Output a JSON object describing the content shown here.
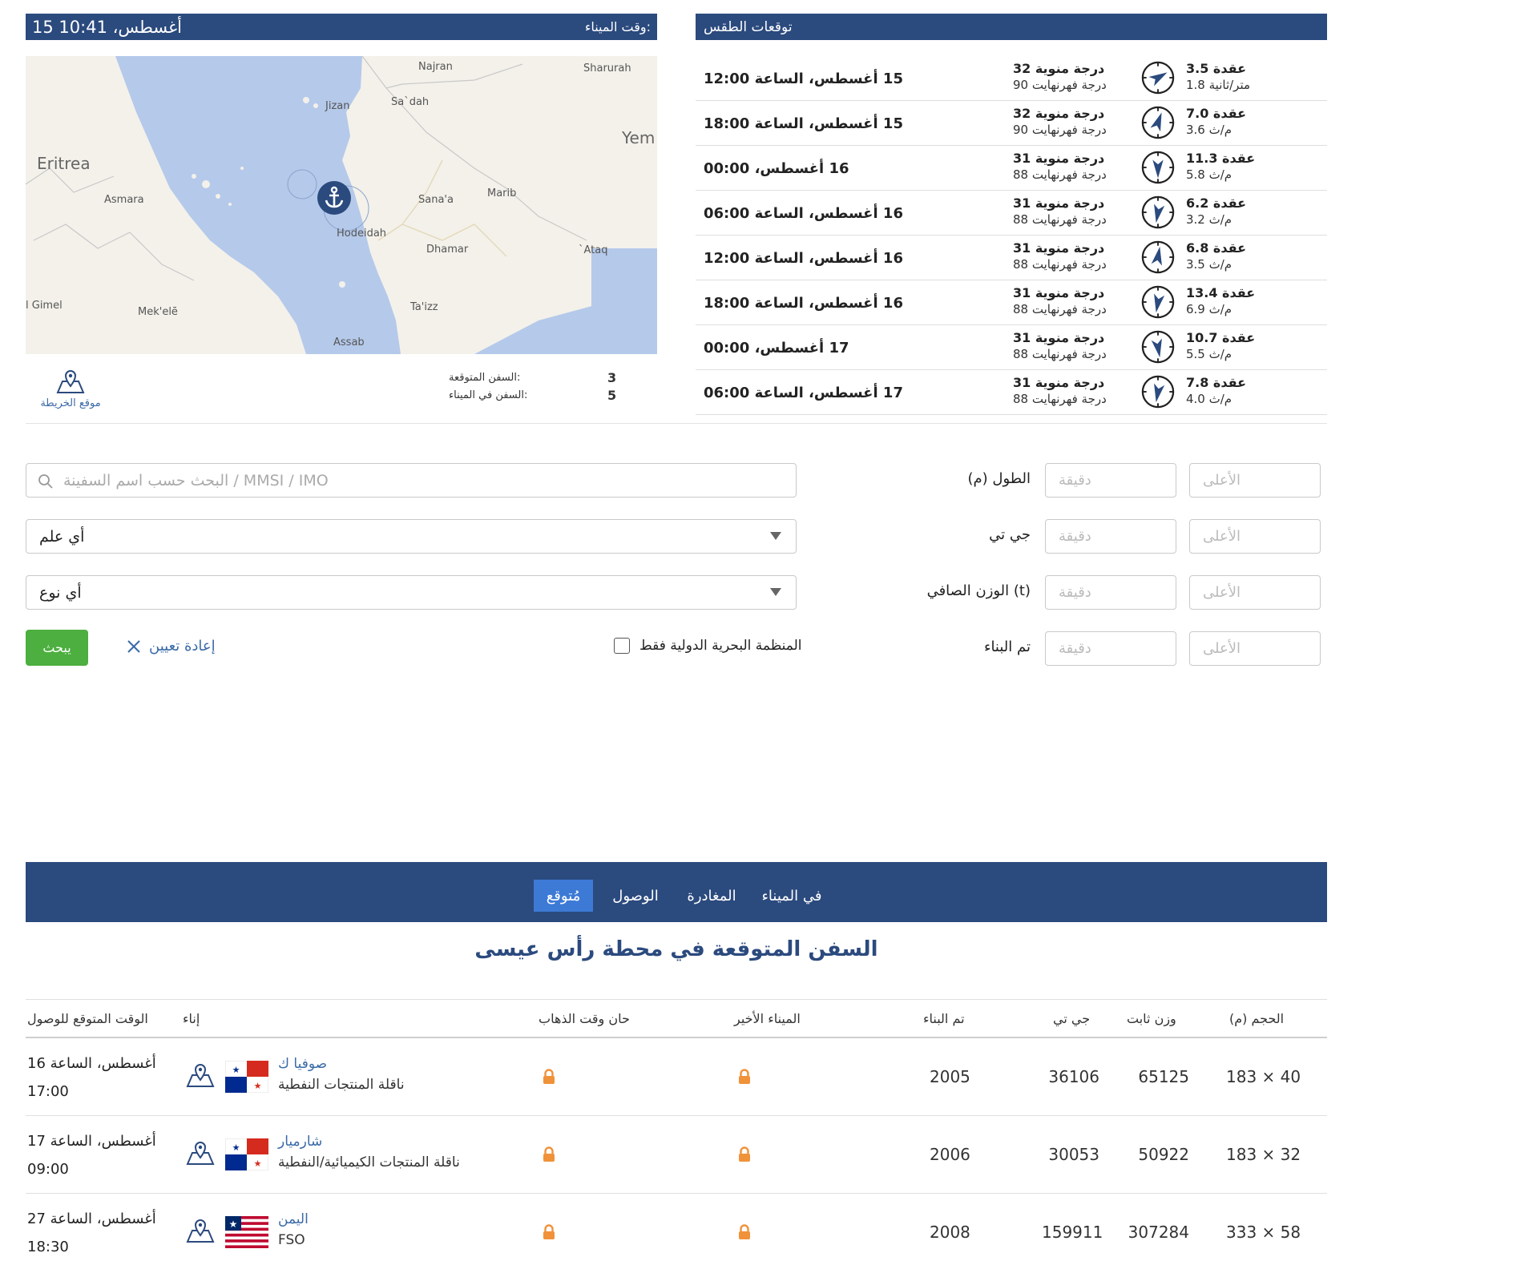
{
  "port_time": {
    "label": "وقت الميناء:",
    "datetime": "15 أغسطس، 10:41"
  },
  "weather": {
    "title": "توقعات الطقس",
    "rows": [
      {
        "date": "15 أغسطس، الساعة 12:00",
        "temp_c": "32 درجة منوية",
        "temp_f": "90 درجة فهرنهايت",
        "wind_knots": "3.5 عقدة",
        "wind_ms": "1.8 متر/ثانية"
      },
      {
        "date": "15 أغسطس، الساعة 18:00",
        "temp_c": "32 درجة منوية",
        "temp_f": "90 درجة فهرنهايت",
        "wind_knots": "7.0 عقدة",
        "wind_ms": "3.6 م/ث"
      },
      {
        "date": "16 أغسطس، 00:00",
        "temp_c": "31 درجة منوية",
        "temp_f": "88 درجة فهرنهايت",
        "wind_knots": "11.3 عقدة",
        "wind_ms": "5.8 م/ث"
      },
      {
        "date": "16 أغسطس، الساعة 06:00",
        "temp_c": "31 درجة منوية",
        "temp_f": "88 درجة فهرنهايت",
        "wind_knots": "6.2 عقدة",
        "wind_ms": "3.2 م/ث"
      },
      {
        "date": "16 أغسطس، الساعة 12:00",
        "temp_c": "31 درجة منوية",
        "temp_f": "88 درجة فهرنهايت",
        "wind_knots": "6.8 عقدة",
        "wind_ms": "3.5 م/ث"
      },
      {
        "date": "16 أغسطس، الساعة 18:00",
        "temp_c": "31 درجة منوية",
        "temp_f": "88 درجة فهرنهايت",
        "wind_knots": "13.4 عقدة",
        "wind_ms": "6.9 م/ث"
      },
      {
        "date": "17 أغسطس، 00:00",
        "temp_c": "31 درجة منوية",
        "temp_f": "88 درجة فهرنهايت",
        "wind_knots": "10.7 عقدة",
        "wind_ms": "5.5 م/ث"
      },
      {
        "date": "17 أغسطس، الساعة 06:00",
        "temp_c": "31 درجة منوية",
        "temp_f": "88 درجة فهرنهايت",
        "wind_knots": "7.8 عقدة",
        "wind_ms": "4.0 م/ث"
      }
    ]
  },
  "map": {
    "labels": [
      "Najran",
      "Sharurah",
      "Jizan",
      "Sa`dah",
      "Yem",
      "Eritrea",
      "Asmara",
      "Sana'a",
      "Marib",
      "Hodeidah",
      "Dhamar",
      "`Ataq",
      "l Gimel",
      "Mek'elē",
      "Ta'izz",
      "Assab"
    ],
    "colors": {
      "sea": "#b5c9ea",
      "land": "#f3f1ea",
      "marker": "#2b4a7e"
    }
  },
  "stats": {
    "expected_label": "السفن المتوقعة:",
    "expected_value": "3",
    "in_port_label": "السفن في الميناء:",
    "in_port_value": "5",
    "map_position": "موقع الخريطة"
  },
  "search": {
    "placeholder": "البحث حسب اسم السفينة / MMSI / IMO",
    "flag_select": "أي علم",
    "type_select": "أي نوع",
    "imo_only": "المنظمة البحرية الدولية فقط",
    "reset": "إعادة تعيين",
    "submit": "يبحث",
    "filters": [
      {
        "label": "الطول (م)",
        "min": "دقيقة",
        "max": "الأعلى"
      },
      {
        "label": "جي تي",
        "min": "دقيقة",
        "max": "الأعلى"
      },
      {
        "label": "الوزن الصافي (t)",
        "min": "دقيقة",
        "max": "الأعلى"
      },
      {
        "label": "تم البناء",
        "min": "دقيقة",
        "max": "الأعلى"
      }
    ]
  },
  "tabs": [
    {
      "label": "في الميناء"
    },
    {
      "label": "المغادرة"
    },
    {
      "label": "الوصول"
    },
    {
      "label": "مُتوقع",
      "active": true
    }
  ],
  "section_title": "السفن المتوقعة في محطة رأس عيسى",
  "table": {
    "headers": {
      "eta": "الوقت المتوقع للوصول",
      "vessel": "إناء",
      "departure": "حان وقت الذهاب",
      "last_port": "الميناء الأخير",
      "built": "تم البناء",
      "gt": "جي تي",
      "dwt": "وزن ثابت",
      "size": "الحجم (م)"
    },
    "rows": [
      {
        "eta_line1": "16 أغسطس، الساعة",
        "eta_line2": "17:00",
        "name": "صوفيا ك",
        "type": "ناقلة المنتجات النفطية",
        "flag": "panama",
        "built": "2005",
        "gt": "36106",
        "dwt": "65125",
        "size": "183 × 40"
      },
      {
        "eta_line1": "17 أغسطس، الساعة",
        "eta_line2": "09:00",
        "name": "شارميار",
        "type": "ناقلة المنتجات الكيميائية/النفطية",
        "flag": "panama",
        "built": "2006",
        "gt": "30053",
        "dwt": "50922",
        "size": "183 × 32"
      },
      {
        "eta_line1": "27 أغسطس، الساعة",
        "eta_line2": "18:30",
        "name": "اليمن",
        "type": "FSO",
        "flag": "liberia",
        "built": "2008",
        "gt": "159911",
        "dwt": "307284",
        "size": "333 × 58"
      }
    ]
  }
}
